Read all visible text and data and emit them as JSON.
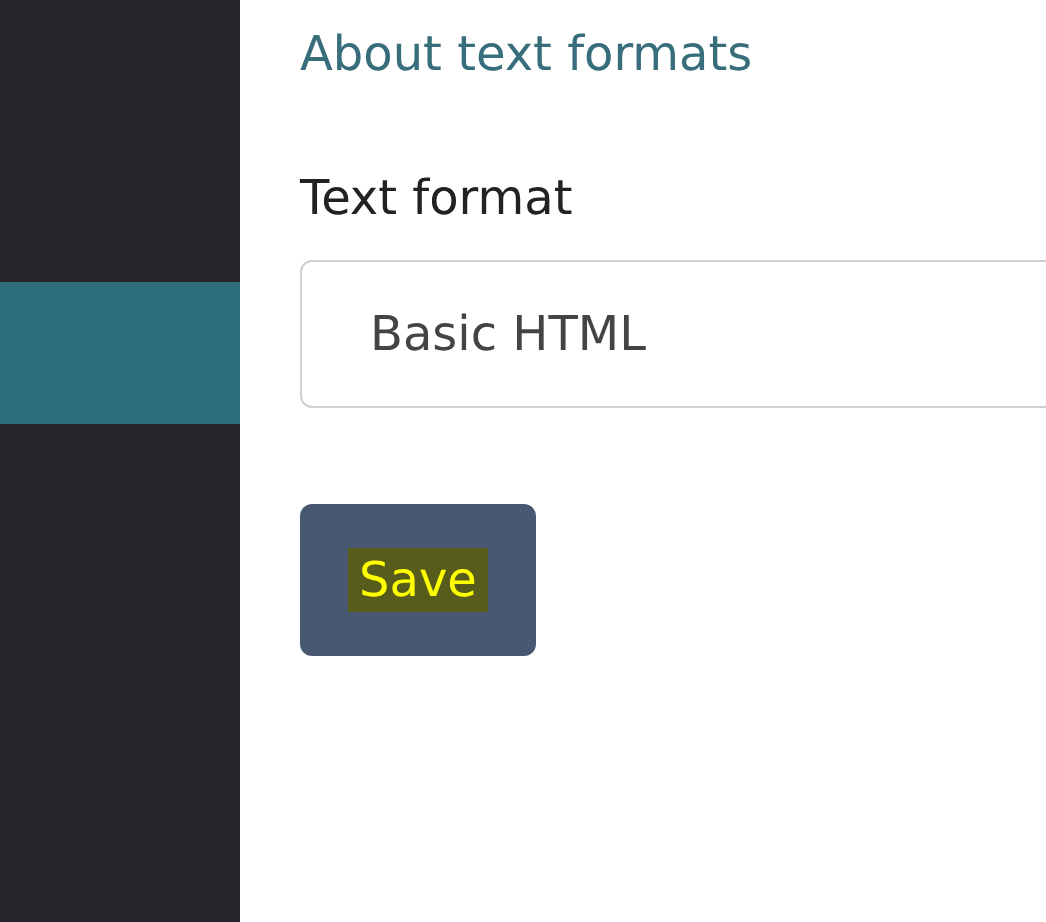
{
  "sidebar": {
    "items": [
      {
        "selected": true
      }
    ]
  },
  "help_link": "About text formats",
  "text_format": {
    "label": "Text format",
    "value": "Basic HTML"
  },
  "save_button": {
    "label": "Save",
    "highlighted": true
  }
}
